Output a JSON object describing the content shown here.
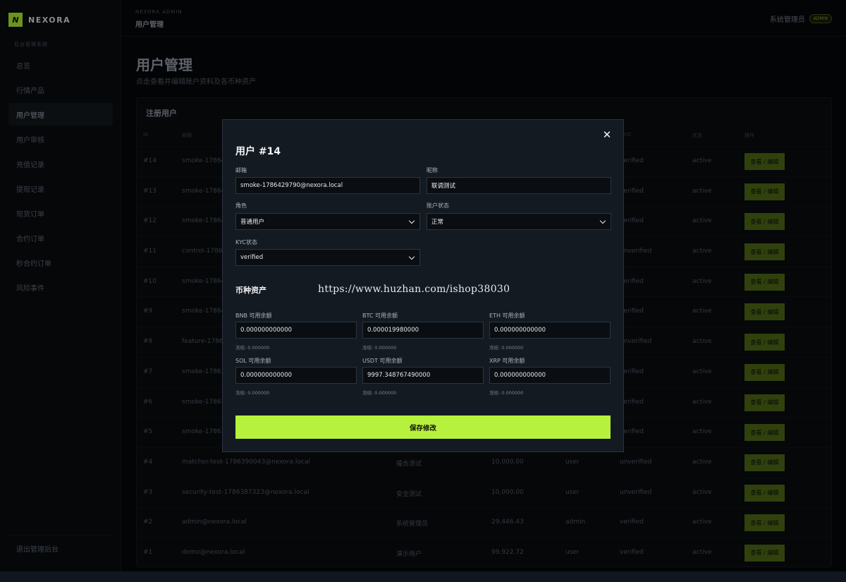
{
  "brand": {
    "name": "NEXORA",
    "logo_letter": "N"
  },
  "sidebar": {
    "section": "后台管理系统",
    "items": [
      {
        "label": "总览",
        "active": false
      },
      {
        "label": "行情产品",
        "active": false
      },
      {
        "label": "用户管理",
        "active": true
      },
      {
        "label": "用户审核",
        "active": false
      },
      {
        "label": "充值记录",
        "active": false
      },
      {
        "label": "提现记录",
        "active": false
      },
      {
        "label": "现货订单",
        "active": false
      },
      {
        "label": "合约订单",
        "active": false
      },
      {
        "label": "秒合约订单",
        "active": false
      },
      {
        "label": "风险事件",
        "active": false
      }
    ],
    "logout": "退出管理后台"
  },
  "header": {
    "subtitle": "NEXORA ADMIN",
    "title": "用户管理",
    "user_name": "系统管理员",
    "user_badge": "ADMIN"
  },
  "page": {
    "title": "用户管理",
    "description": "点击查看并编辑账户资料及各币种资产"
  },
  "table": {
    "title": "注册用户",
    "columns": {
      "id": "ID",
      "email": "邮箱",
      "kyc": "KYC",
      "status": "状态",
      "actions": "操作"
    },
    "edit_label": "查看 / 编辑",
    "rows": [
      {
        "id": "#14",
        "email": "smoke-17864",
        "nickname": "",
        "balance": "",
        "role": "",
        "kyc": "verified",
        "status": "active"
      },
      {
        "id": "#13",
        "email": "smoke-17864",
        "nickname": "",
        "balance": "",
        "role": "",
        "kyc": "verified",
        "status": "active"
      },
      {
        "id": "#12",
        "email": "smoke-17864",
        "nickname": "",
        "balance": "",
        "role": "",
        "kyc": "verified",
        "status": "active"
      },
      {
        "id": "#11",
        "email": "control-1786",
        "nickname": "",
        "balance": "",
        "role": "",
        "kyc": "unverified",
        "status": "active"
      },
      {
        "id": "#10",
        "email": "smoke-17864",
        "nickname": "",
        "balance": "",
        "role": "",
        "kyc": "verified",
        "status": "active"
      },
      {
        "id": "#9",
        "email": "smoke-17864",
        "nickname": "",
        "balance": "",
        "role": "",
        "kyc": "verified",
        "status": "active"
      },
      {
        "id": "#8",
        "email": "feature-1786",
        "nickname": "",
        "balance": "",
        "role": "",
        "kyc": "unverified",
        "status": "active"
      },
      {
        "id": "#7",
        "email": "smoke-17863",
        "nickname": "",
        "balance": "",
        "role": "",
        "kyc": "verified",
        "status": "active"
      },
      {
        "id": "#6",
        "email": "smoke-17863",
        "nickname": "",
        "balance": "",
        "role": "",
        "kyc": "verified",
        "status": "active"
      },
      {
        "id": "#5",
        "email": "smoke-17863",
        "nickname": "",
        "balance": "",
        "role": "",
        "kyc": "verified",
        "status": "active"
      },
      {
        "id": "#4",
        "email": "matcher-test-1786390043@nexora.local",
        "nickname": "撮合测试",
        "balance": "10,000.00",
        "role": "user",
        "kyc": "unverified",
        "status": "active"
      },
      {
        "id": "#3",
        "email": "security-test-1786387323@nexora.local",
        "nickname": "安全测试",
        "balance": "10,000.00",
        "role": "user",
        "kyc": "unverified",
        "status": "active"
      },
      {
        "id": "#2",
        "email": "admin@nexora.local",
        "nickname": "系统管理员",
        "balance": "29,446.43",
        "role": "admin",
        "kyc": "verified",
        "status": "active"
      },
      {
        "id": "#1",
        "email": "demo@nexora.local",
        "nickname": "演示用户",
        "balance": "99,922.72",
        "role": "user",
        "kyc": "verified",
        "status": "active"
      }
    ]
  },
  "modal": {
    "title": "用户 #14",
    "email_label": "邮箱",
    "email_value": "smoke-1786429790@nexora.local",
    "nickname_label": "昵称",
    "nickname_value": "联调测试",
    "role_label": "角色",
    "role_value": "普通用户",
    "status_label": "账户状态",
    "status_value": "正常",
    "kyc_label": "KYC状态",
    "kyc_value": "verified",
    "assets_title": "币种资产",
    "watermark": "https://www.huzhan.com/ishop38030",
    "assets": [
      {
        "label": "BNB 可用余额",
        "value": "0.000000000000",
        "frozen": "冻结: 0.000000"
      },
      {
        "label": "BTC 可用余额",
        "value": "0.000019980000",
        "frozen": "冻结: 0.000000"
      },
      {
        "label": "ETH 可用余额",
        "value": "0.000000000000",
        "frozen": "冻结: 0.000000"
      },
      {
        "label": "SOL 可用余额",
        "value": "0.000000000000",
        "frozen": "冻结: 0.000000"
      },
      {
        "label": "USDT 可用余额",
        "value": "9997.348767490000",
        "frozen": "冻结: 0.000000"
      },
      {
        "label": "XRP 可用余额",
        "value": "0.000000000000",
        "frozen": "冻结: 0.000000"
      }
    ],
    "save_label": "保存修改",
    "close_glyph": "✕"
  }
}
